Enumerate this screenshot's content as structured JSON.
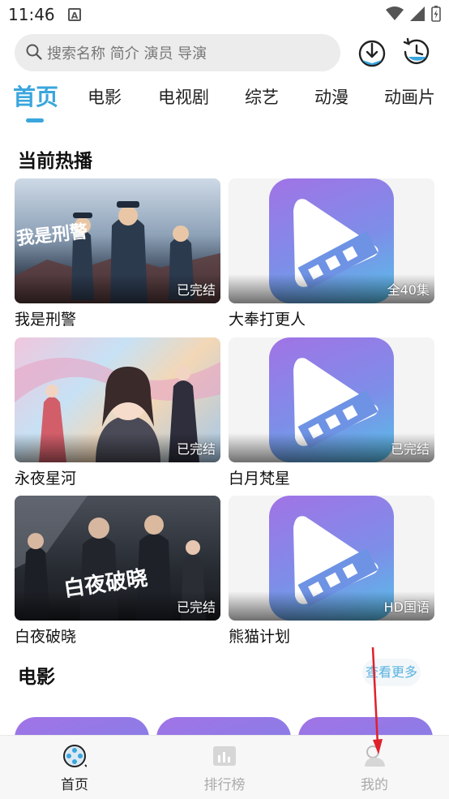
{
  "status_bar": {
    "time": "11:46",
    "notification_icon": "A"
  },
  "search": {
    "placeholder": "搜索名称 简介 演员 导演"
  },
  "tabs": [
    {
      "label": "首页",
      "active": true
    },
    {
      "label": "电影"
    },
    {
      "label": "电视剧"
    },
    {
      "label": "综艺"
    },
    {
      "label": "动漫"
    },
    {
      "label": "动画片"
    }
  ],
  "sections": {
    "hot": {
      "title": "当前热播"
    },
    "movies": {
      "title": "电影",
      "more": "查看更多"
    }
  },
  "hot_items": [
    {
      "title": "我是刑警",
      "badge": "已完结",
      "poster_text": "我是刑警"
    },
    {
      "title": "大奉打更人",
      "badge": "全40集"
    },
    {
      "title": "永夜星河",
      "badge": "已完结"
    },
    {
      "title": "白月梵星",
      "badge": "已完结"
    },
    {
      "title": "白夜破晓",
      "badge": "已完结",
      "poster_text": "白夜破晓"
    },
    {
      "title": "熊猫计划",
      "badge": "HD国语"
    }
  ],
  "bottom_nav": [
    {
      "label": "首页",
      "icon": "film-reel-icon",
      "active": true
    },
    {
      "label": "排行榜",
      "icon": "bar-chart-icon"
    },
    {
      "label": "我的",
      "icon": "profile-icon"
    }
  ],
  "colors": {
    "accent": "#3aa6dd",
    "annotation_arrow": "#e0202a"
  }
}
